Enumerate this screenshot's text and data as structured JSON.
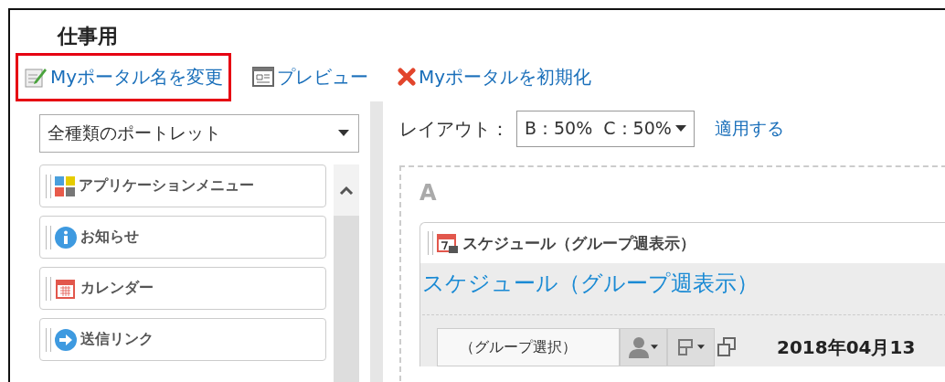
{
  "page": {
    "title": "仕事用"
  },
  "actions": [
    {
      "kind": "rename",
      "label": "Myポータル名を変更",
      "highlighted": true
    },
    {
      "kind": "preview",
      "label": "プレビュー",
      "highlighted": false
    },
    {
      "kind": "reset",
      "label": "Myポータルを初期化",
      "highlighted": false
    }
  ],
  "palette": {
    "filter": "全種類のポートレット",
    "items": [
      {
        "kind": "apps",
        "label": "アプリケーションメニュー"
      },
      {
        "kind": "info",
        "label": "お知らせ"
      },
      {
        "kind": "calendar",
        "label": "カレンダー"
      },
      {
        "kind": "link",
        "label": "送信リンク"
      }
    ]
  },
  "layout": {
    "label": "レイアウト：",
    "value": "B：50%  C：50%",
    "apply": "適用する"
  },
  "zone": {
    "name": "A",
    "portlet": {
      "header": "スケジュール（グループ週表示）",
      "title": "スケジュール（グループ週表示）",
      "group_select": "（グループ選択）",
      "date": "2018年04月13"
    }
  }
}
